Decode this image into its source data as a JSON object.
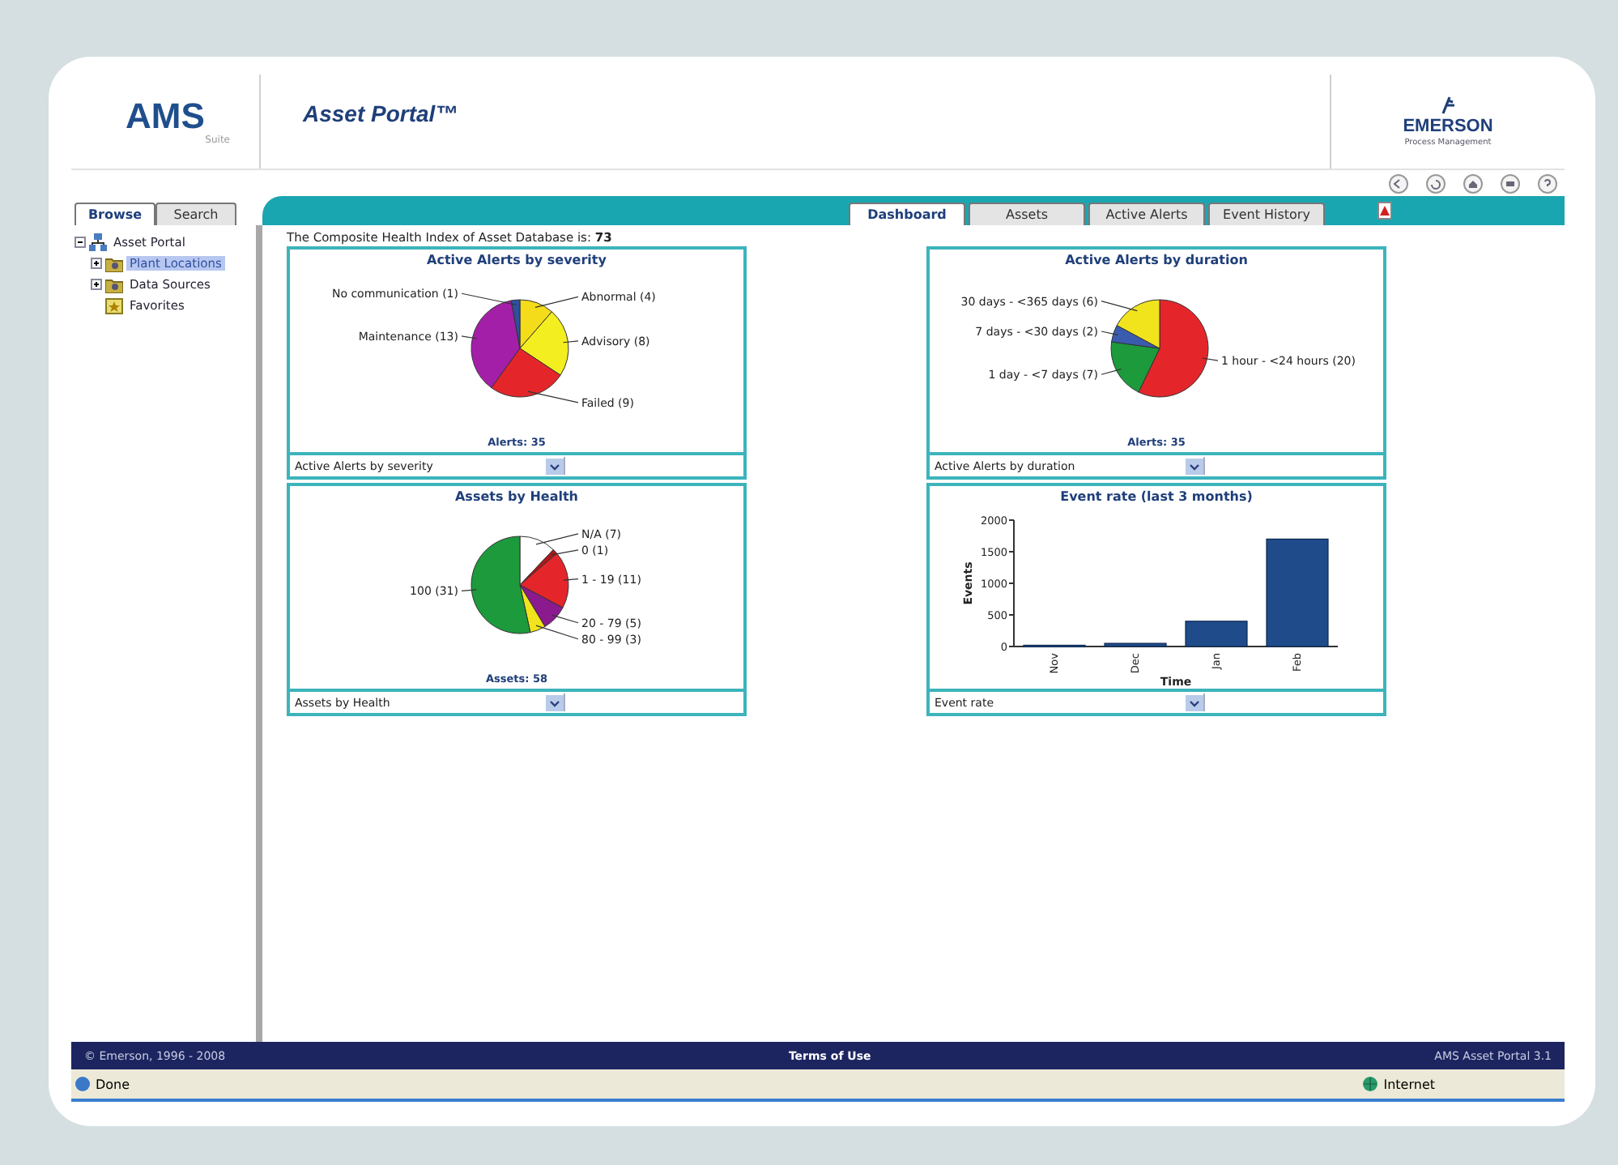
{
  "header": {
    "logo": "AMS",
    "logo_sub": "Suite",
    "title": "Asset Portal™",
    "brand": "EMERSON",
    "brand_sub": "Process Management"
  },
  "left_tabs": [
    {
      "label": "Browse",
      "selected": true
    },
    {
      "label": "Search",
      "selected": false
    }
  ],
  "tree": [
    {
      "label": "Asset Portal",
      "expanded": true,
      "selected": false,
      "kind": "network",
      "children": [
        {
          "label": "Plant Locations",
          "expanded": false,
          "selected": true,
          "kind": "folder"
        },
        {
          "label": "Data Sources",
          "expanded": false,
          "selected": false,
          "kind": "folder"
        },
        {
          "label": "Favorites",
          "selected": false,
          "kind": "star"
        }
      ]
    }
  ],
  "main_tabs": [
    {
      "label": "Dashboard",
      "selected": true
    },
    {
      "label": "Assets",
      "selected": false
    },
    {
      "label": "Active Alerts",
      "selected": false
    },
    {
      "label": "Event History",
      "selected": false
    }
  ],
  "health_index": {
    "label": "The Composite Health Index of Asset Database is:",
    "value": "73"
  },
  "panels": [
    {
      "total": "Alerts: 35",
      "select": "Active Alerts by severity",
      "chart_data": {
        "type": "pie",
        "title": "Active Alerts by severity",
        "categories": [
          "Abnormal (4)",
          "Advisory (8)",
          "Failed (9)",
          "Maintenance (13)",
          "No communication (1)"
        ],
        "values": [
          4,
          8,
          9,
          13,
          1
        ],
        "colors": [
          "#f5dc1a",
          "#f2ee20",
          "#e4262a",
          "#a41fa8",
          "#2f4fa0"
        ]
      }
    },
    {
      "total": "Alerts: 35",
      "select": "Active Alerts by duration",
      "chart_data": {
        "type": "pie",
        "title": "Active Alerts by duration",
        "categories": [
          "1 hour - <24 hours (20)",
          "1 day - <7 days (7)",
          "7 days - <30 days (2)",
          "30 days - <365 days (6)"
        ],
        "values": [
          20,
          7,
          2,
          6
        ],
        "colors": [
          "#e4262a",
          "#1c9a3c",
          "#3b5cae",
          "#f2e41c"
        ]
      }
    },
    {
      "total": "Assets: 58",
      "select": "Assets by Health",
      "chart_data": {
        "type": "pie",
        "title": "Assets by Health",
        "categories": [
          "N/A (7)",
          "0 (1)",
          "1 - 19 (11)",
          "20 - 79 (5)",
          "80 - 99 (3)",
          "100 (31)"
        ],
        "values": [
          7,
          1,
          11,
          5,
          3,
          31
        ],
        "colors": [
          "#ffffff",
          "#b01818",
          "#e4262a",
          "#8a1a8e",
          "#f2e41c",
          "#1c9a3c"
        ]
      }
    },
    {
      "select": "Event rate",
      "chart_data": {
        "type": "bar",
        "title": "Event rate (last 3 months)",
        "xlabel": "Time",
        "ylabel": "Events",
        "categories": [
          "Nov",
          "Dec",
          "Jan",
          "Feb"
        ],
        "values": [
          20,
          50,
          400,
          1700
        ],
        "ylim": [
          0,
          2000
        ],
        "yticks": [
          0,
          500,
          1000,
          1500,
          2000
        ]
      }
    }
  ],
  "footer": {
    "copyright": "© Emerson, 1996 - 2008",
    "link": "Terms of Use",
    "version": "AMS Asset Portal 3.1"
  },
  "status_bar": {
    "status": "Done",
    "zone": "Internet"
  }
}
